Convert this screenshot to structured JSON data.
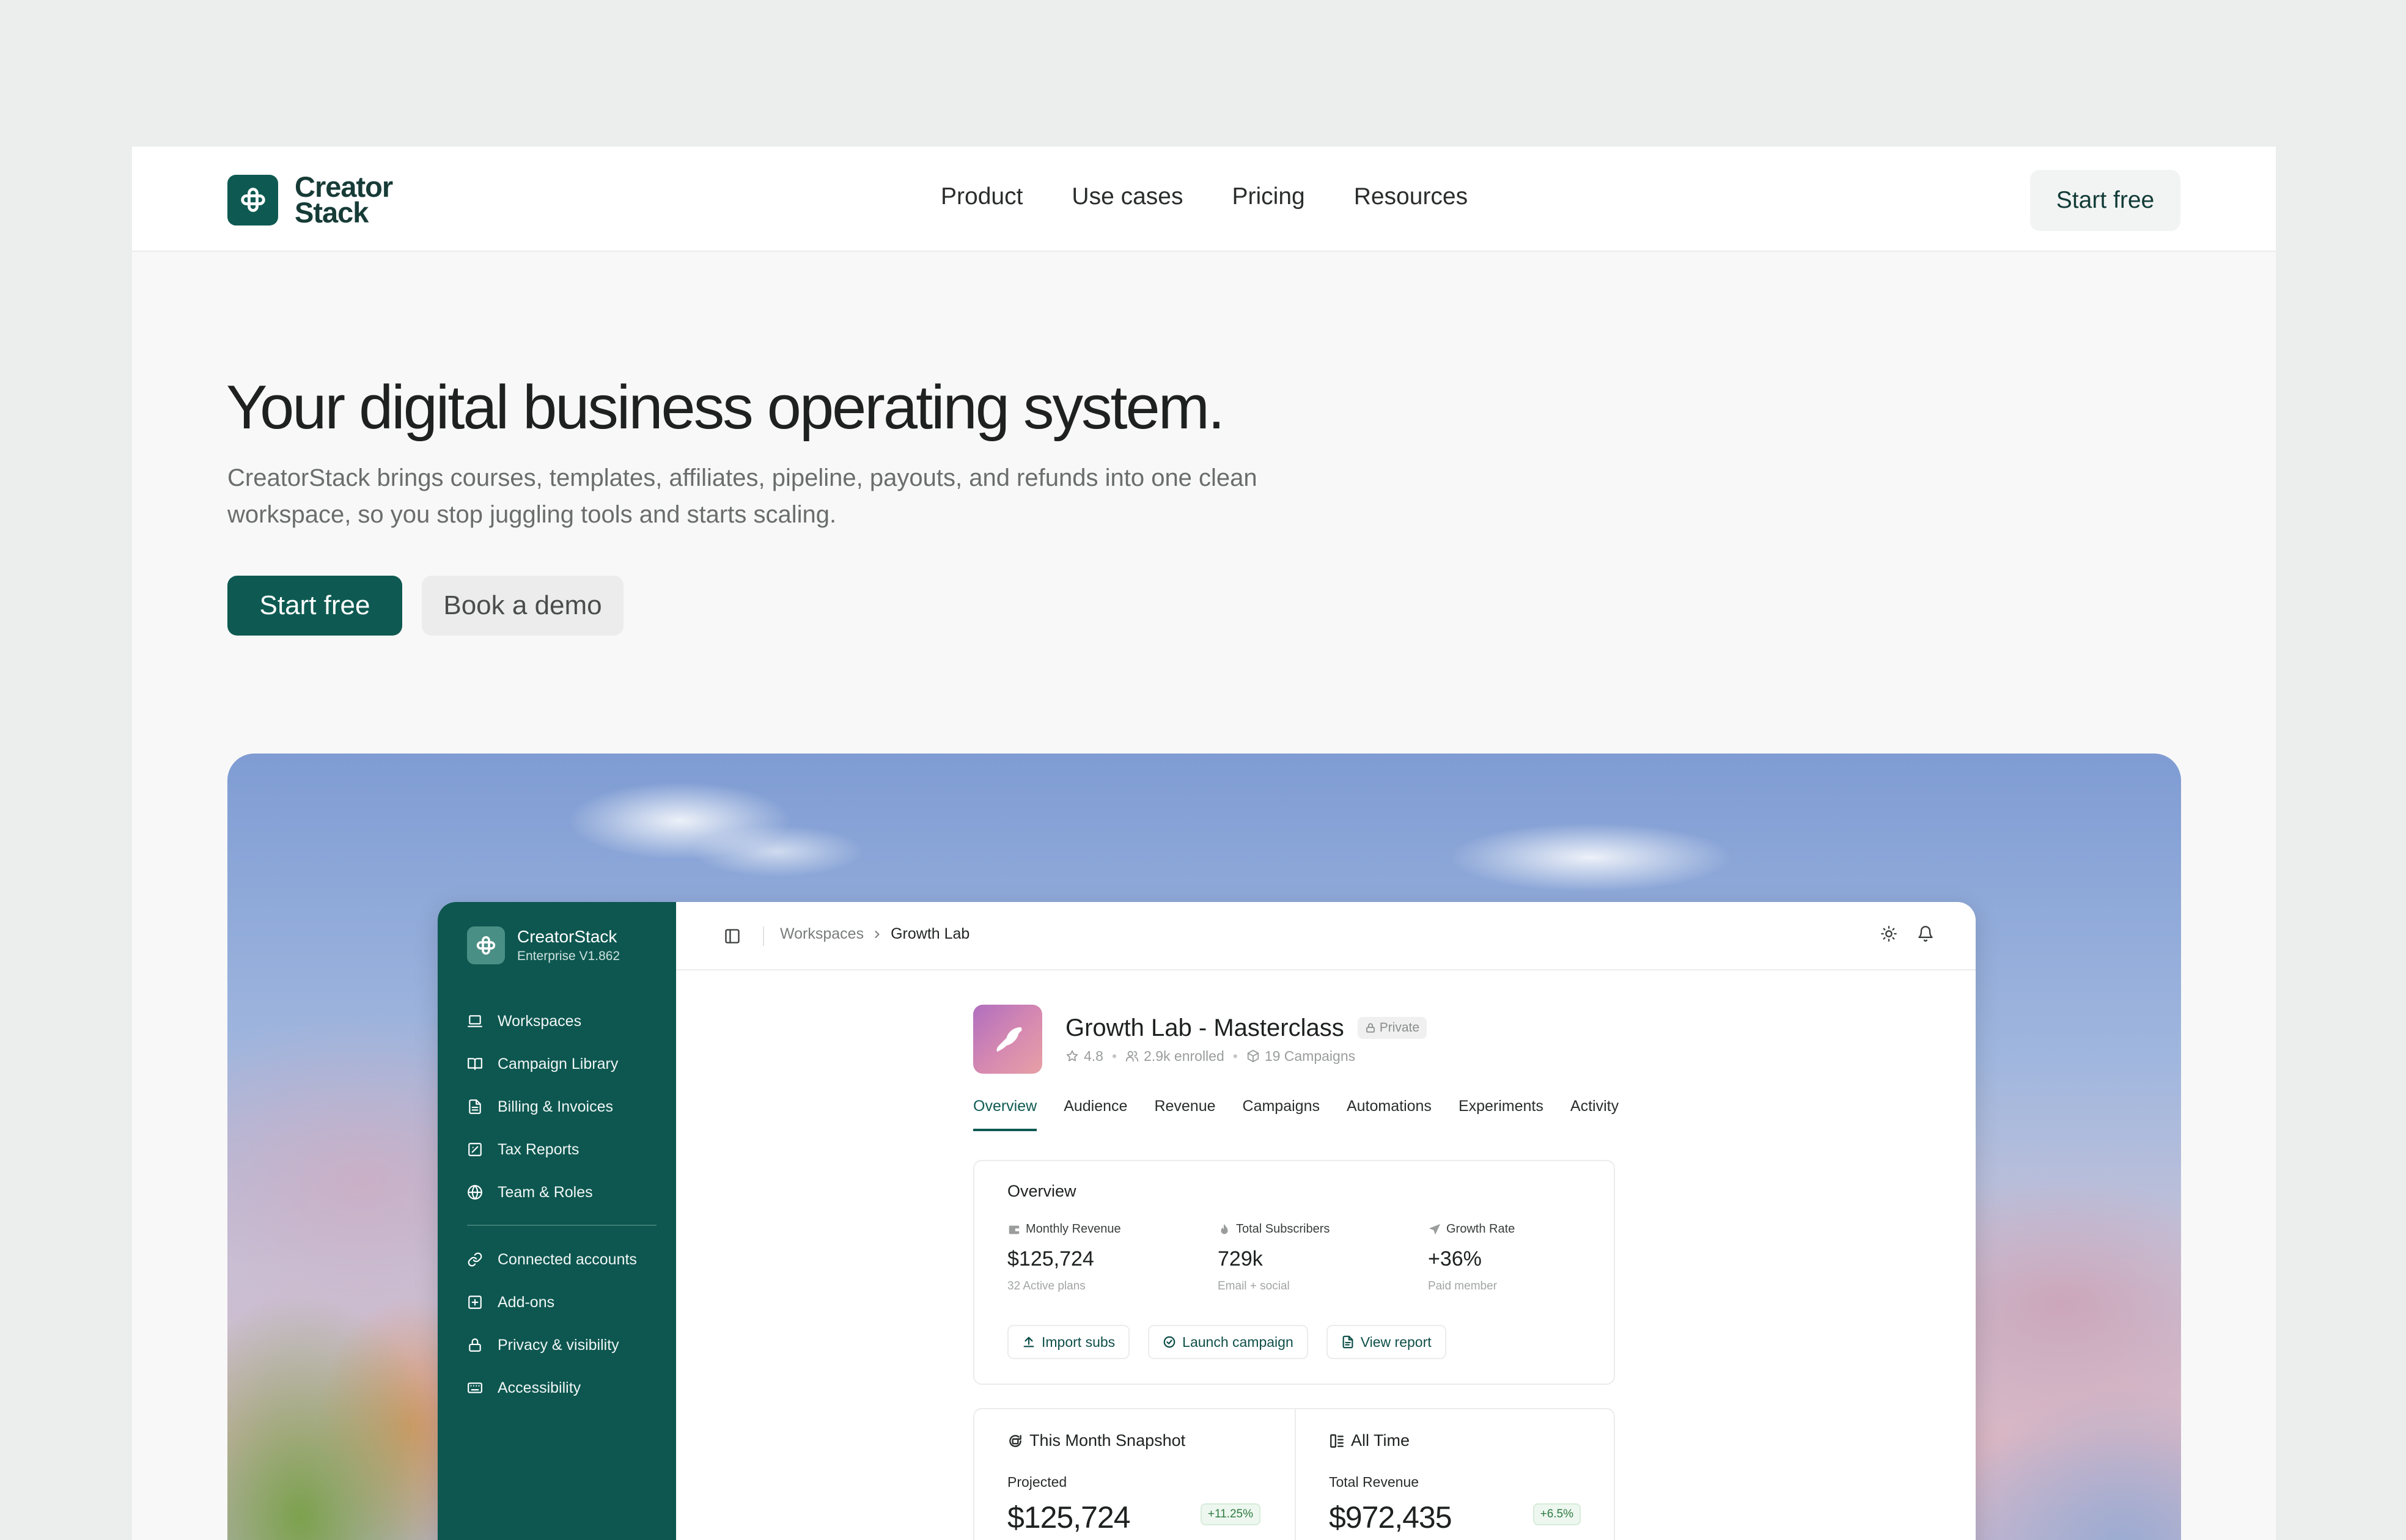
{
  "brand": {
    "line1": "Creator",
    "line2": "Stack",
    "color": "#0e5a52"
  },
  "nav": {
    "links": [
      "Product",
      "Use cases",
      "Pricing",
      "Resources"
    ],
    "cta": "Start free"
  },
  "hero": {
    "title": "Your digital business operating system.",
    "subtitle": "CreatorStack brings courses, templates, affiliates, pipeline, payouts, and refunds into one clean workspace, so you stop juggling tools and starts scaling.",
    "primary_cta": "Start free",
    "secondary_cta": "Book a demo"
  },
  "app": {
    "sidebar": {
      "name": "CreatorStack",
      "version": "Enterprise V1.862",
      "primary_items": [
        {
          "label": "Workspaces",
          "icon": "laptop-icon"
        },
        {
          "label": "Campaign Library",
          "icon": "book-open-icon"
        },
        {
          "label": "Billing & Invoices",
          "icon": "file-text-icon"
        },
        {
          "label": "Tax Reports",
          "icon": "check-square-icon"
        },
        {
          "label": "Team & Roles",
          "icon": "globe-icon"
        }
      ],
      "secondary_items": [
        {
          "label": "Connected accounts",
          "icon": "link-icon"
        },
        {
          "label": "Add-ons",
          "icon": "plus-square-icon"
        },
        {
          "label": "Privacy & visibility",
          "icon": "lock-icon"
        },
        {
          "label": "Accessibility",
          "icon": "keyboard-icon"
        }
      ]
    },
    "breadcrumb": {
      "parent": "Workspaces",
      "current": "Growth Lab"
    },
    "course": {
      "title": "Growth Lab - Masterclass",
      "visibility": "Private",
      "rating": "4.8",
      "enrolled": "2.9k enrolled",
      "campaigns": "19 Campaigns"
    },
    "tabs": [
      "Overview",
      "Audience",
      "Revenue",
      "Campaigns",
      "Automations",
      "Experiments",
      "Activity"
    ],
    "active_tab": "Overview",
    "overview": {
      "title": "Overview",
      "metrics": [
        {
          "label": "Monthly Revenue",
          "value": "$125,724",
          "note": "32 Active plans",
          "icon": "wallet-icon"
        },
        {
          "label": "Total Subscribers",
          "value": "729k",
          "note": "Email + social",
          "icon": "flame-icon"
        },
        {
          "label": "Growth Rate",
          "value": "+36%",
          "note": "Paid member",
          "icon": "send-icon"
        }
      ],
      "actions": [
        {
          "label": "Import subs",
          "icon": "upload-icon"
        },
        {
          "label": "Launch campaign",
          "icon": "check-circle-icon"
        },
        {
          "label": "View report",
          "icon": "file-icon"
        }
      ]
    },
    "snapshot": {
      "month": {
        "title": "This Month Snapshot",
        "label": "Projected",
        "value": "$125,724",
        "delta": "+11.25%"
      },
      "all_time": {
        "title": "All Time",
        "label": "Total Revenue",
        "value": "$972,435",
        "delta": "+6.5%"
      }
    }
  }
}
